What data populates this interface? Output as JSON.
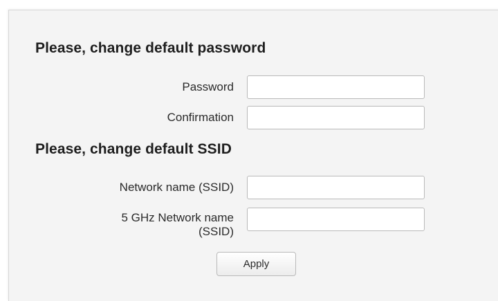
{
  "password_section": {
    "title": "Please, change default password",
    "password_label": "Password",
    "password_value": "",
    "confirmation_label": "Confirmation",
    "confirmation_value": ""
  },
  "ssid_section": {
    "title": "Please, change default SSID",
    "ssid_label": "Network name (SSID)",
    "ssid_value": "",
    "ssid5_label_line1": "5 GHz Network name",
    "ssid5_label_line2": "(SSID)",
    "ssid5_value": ""
  },
  "actions": {
    "apply_label": "Apply"
  }
}
